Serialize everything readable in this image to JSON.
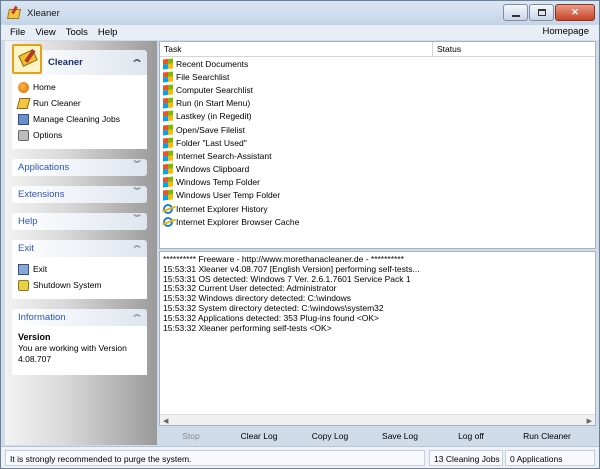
{
  "window": {
    "title": "Xleaner"
  },
  "menu": {
    "items": [
      "File",
      "View",
      "Tools",
      "Help"
    ],
    "homepage": "Homepage"
  },
  "sidebar": {
    "cleaner": {
      "title": "Cleaner",
      "items": [
        "Home",
        "Run Cleaner",
        "Manage Cleaning Jobs",
        "Options"
      ]
    },
    "applications": {
      "title": "Applications"
    },
    "extensions": {
      "title": "Extensions"
    },
    "help": {
      "title": "Help"
    },
    "exit": {
      "title": "Exit",
      "items": [
        "Exit",
        "Shutdown System"
      ]
    },
    "information": {
      "title": "Information",
      "heading": "Version",
      "line1": "You are working with Version",
      "line2": "4.08.707"
    }
  },
  "tasks": {
    "columns": [
      "Task",
      "Status"
    ],
    "rows": [
      {
        "name": "Recent Documents",
        "icon": "windows-icon",
        "status": ""
      },
      {
        "name": "File Searchlist",
        "icon": "windows-icon",
        "status": ""
      },
      {
        "name": "Computer Searchlist",
        "icon": "windows-icon",
        "status": ""
      },
      {
        "name": "Run (in Start Menu)",
        "icon": "windows-icon",
        "status": ""
      },
      {
        "name": "Lastkey (in Regedit)",
        "icon": "windows-icon",
        "status": ""
      },
      {
        "name": "Open/Save Filelist",
        "icon": "windows-icon",
        "status": ""
      },
      {
        "name": "Folder \"Last Used\"",
        "icon": "windows-icon",
        "status": ""
      },
      {
        "name": "Internet Search-Assistant",
        "icon": "windows-icon",
        "status": ""
      },
      {
        "name": "Windows Clipboard",
        "icon": "windows-icon",
        "status": ""
      },
      {
        "name": "Windows Temp Folder",
        "icon": "windows-icon",
        "status": ""
      },
      {
        "name": "Windows User Temp Folder",
        "icon": "windows-icon",
        "status": ""
      },
      {
        "name": "Internet Explorer History",
        "icon": "ie-icon",
        "status": ""
      },
      {
        "name": "Internet Explorer Browser Cache",
        "icon": "ie-icon",
        "status": ""
      }
    ]
  },
  "log": {
    "lines": [
      "********** Freeware - http://www.morethanacleaner.de - **********",
      "15:53:31 Xleaner v4.08.707 [English Version] performing self-tests...",
      "15:53:31 OS detected: Windows 7 Ver. 2.6.1.7601 Service Pack 1",
      "15:53:32 Current User detected: Administrator",
      "15:53:32 Windows directory detected: C:\\windows",
      "15:53:32 System directory detected: C:\\windows\\system32",
      "15:53:32 Applications detected: 353 Plug-ins found <OK>",
      "15:53:32 Xleaner performing self-tests <OK>"
    ]
  },
  "actions": {
    "stop": "Stop",
    "clear_log": "Clear Log",
    "copy_log": "Copy Log",
    "save_log": "Save Log",
    "log_off": "Log off",
    "run_cleaner": "Run Cleaner"
  },
  "status": {
    "message": "It is strongly recommended to purge the system.",
    "jobs": "13 Cleaning Jobs",
    "applications": "0 Applications"
  },
  "colors": {
    "panel_title": "#2a56b8",
    "titlebar": "#c4d4e7",
    "close_button": "#c8452a"
  }
}
